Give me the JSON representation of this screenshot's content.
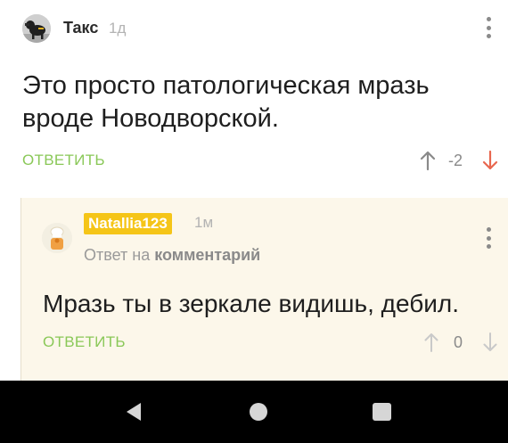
{
  "top_comment": {
    "author": "Такс",
    "time": "1д",
    "text": "Это просто патологическая мразь вроде Новодворской.",
    "reply_label": "ОТВЕТИТЬ",
    "rating": "-2",
    "avatar_icon": "avatar-dachshund-icon"
  },
  "reply_comment": {
    "author": "Natallia123",
    "time": "1м",
    "reply_to_prefix": "Ответ на",
    "reply_to_link": "комментарий",
    "text": "Мразь ты в зеркале видишь, дебил.",
    "reply_label": "ОТВЕТИТЬ",
    "rating": "0",
    "avatar_icon": "avatar-chef-icon"
  },
  "colors": {
    "accent_green": "#8ac858",
    "downvote_red": "#e8674f",
    "author_badge": "#f5c518",
    "reply_bg": "#fcf7ea"
  },
  "navbar": {
    "back_icon": "back-triangle-icon",
    "home_icon": "home-circle-icon",
    "recent_icon": "recent-square-icon"
  }
}
